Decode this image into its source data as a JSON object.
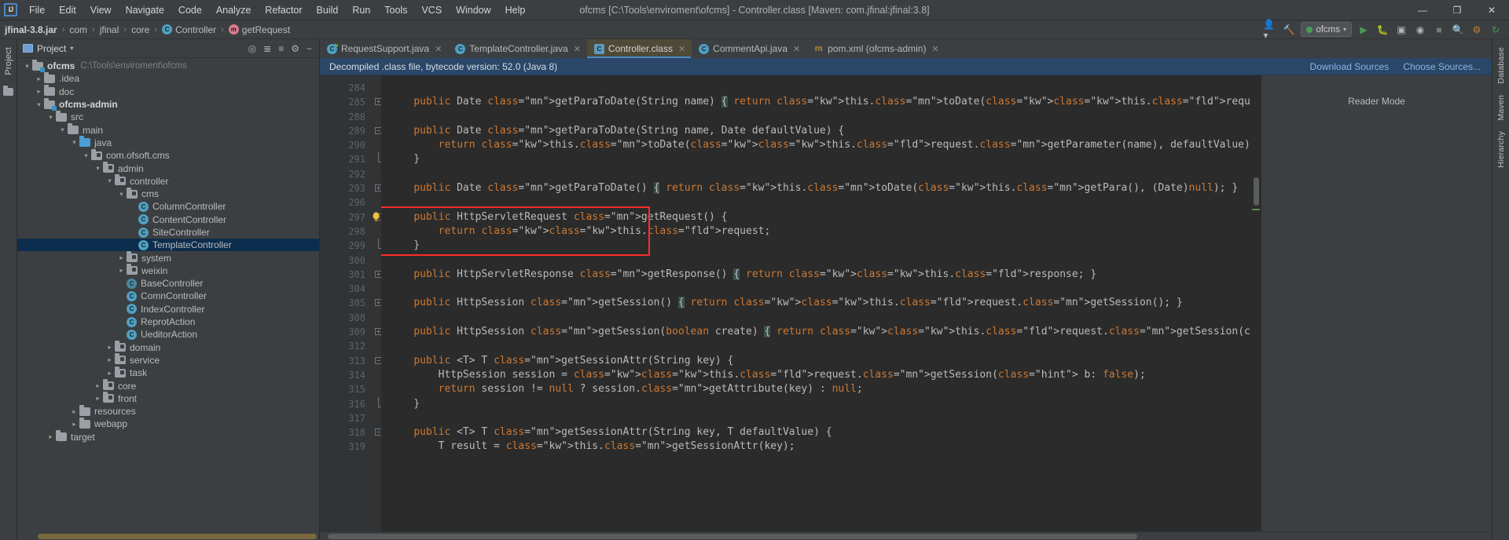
{
  "window": {
    "title": "ofcms [C:\\Tools\\enviroment\\ofcms] - Controller.class [Maven: com.jfinal:jfinal:3.8]",
    "logo": "IJ",
    "minimize": "—",
    "maximize": "❐",
    "close": "✕"
  },
  "menu": [
    {
      "label": "File"
    },
    {
      "label": "Edit"
    },
    {
      "label": "View"
    },
    {
      "label": "Navigate"
    },
    {
      "label": "Code"
    },
    {
      "label": "Analyze"
    },
    {
      "label": "Refactor"
    },
    {
      "label": "Build"
    },
    {
      "label": "Run"
    },
    {
      "label": "Tools"
    },
    {
      "label": "VCS"
    },
    {
      "label": "Window"
    },
    {
      "label": "Help"
    }
  ],
  "breadcrumb": {
    "items": [
      {
        "label": "jfinal-3.8.jar",
        "icon": "none",
        "bold": true
      },
      {
        "label": "com",
        "icon": "none",
        "bold": false
      },
      {
        "label": "jfinal",
        "icon": "none",
        "bold": false
      },
      {
        "label": "core",
        "icon": "none",
        "bold": false
      },
      {
        "label": "Controller",
        "icon": "class-icon",
        "bold": false
      },
      {
        "label": "getRequest",
        "icon": "method-icon",
        "bold": false
      }
    ],
    "separator": "›",
    "class_glyph": "C",
    "method_glyph": "m"
  },
  "navbar_right": {
    "run_config": "ofcms",
    "icons": [
      "user-icon",
      "hammer-icon",
      "run-icon",
      "debug-icon",
      "coverage-icon",
      "profile-icon",
      "stop-icon",
      "search-icon",
      "settings-icon",
      "update-icon"
    ]
  },
  "left_rail": {
    "label": "Project",
    "icon": "folder-icon"
  },
  "right_rail": {
    "items": [
      "Database",
      "Maven",
      "Hierarchy"
    ]
  },
  "project_panel": {
    "title": "Project",
    "header_icons": [
      "target-icon",
      "collapse-icon",
      "expand-icon",
      "gear-icon",
      "hide-icon"
    ],
    "tree": [
      {
        "indent": 0,
        "arrow": "⌄",
        "kind": "folder-module",
        "label": "ofcms",
        "bold": true,
        "path": "C:\\Tools\\enviroment\\ofcms",
        "selected": false
      },
      {
        "indent": 1,
        "arrow": "›",
        "kind": "folder",
        "label": ".idea",
        "bold": false,
        "path": "",
        "selected": false
      },
      {
        "indent": 1,
        "arrow": "›",
        "kind": "folder",
        "label": "doc",
        "bold": false,
        "path": "",
        "selected": false
      },
      {
        "indent": 1,
        "arrow": "⌄",
        "kind": "folder-module",
        "label": "ofcms-admin",
        "bold": true,
        "path": "",
        "selected": false
      },
      {
        "indent": 2,
        "arrow": "⌄",
        "kind": "folder",
        "label": "src",
        "bold": false,
        "path": "",
        "selected": false
      },
      {
        "indent": 3,
        "arrow": "⌄",
        "kind": "folder",
        "label": "main",
        "bold": false,
        "path": "",
        "selected": false
      },
      {
        "indent": 4,
        "arrow": "⌄",
        "kind": "folder-blue",
        "label": "java",
        "bold": false,
        "path": "",
        "selected": false
      },
      {
        "indent": 5,
        "arrow": "⌄",
        "kind": "package",
        "label": "com.ofsoft.cms",
        "bold": false,
        "path": "",
        "selected": false
      },
      {
        "indent": 6,
        "arrow": "⌄",
        "kind": "package",
        "label": "admin",
        "bold": false,
        "path": "",
        "selected": false
      },
      {
        "indent": 7,
        "arrow": "⌄",
        "kind": "package",
        "label": "controller",
        "bold": false,
        "path": "",
        "selected": false
      },
      {
        "indent": 8,
        "arrow": "⌄",
        "kind": "package",
        "label": "cms",
        "bold": false,
        "path": "",
        "selected": false
      },
      {
        "indent": 9,
        "arrow": "",
        "kind": "class",
        "label": "ColumnController",
        "bold": false,
        "path": "",
        "selected": false
      },
      {
        "indent": 9,
        "arrow": "",
        "kind": "class",
        "label": "ContentController",
        "bold": false,
        "path": "",
        "selected": false
      },
      {
        "indent": 9,
        "arrow": "",
        "kind": "class",
        "label": "SiteController",
        "bold": false,
        "path": "",
        "selected": false
      },
      {
        "indent": 9,
        "arrow": "",
        "kind": "class",
        "label": "TemplateController",
        "bold": false,
        "path": "",
        "selected": true
      },
      {
        "indent": 8,
        "arrow": "›",
        "kind": "package",
        "label": "system",
        "bold": false,
        "path": "",
        "selected": false
      },
      {
        "indent": 8,
        "arrow": "›",
        "kind": "package",
        "label": "weixin",
        "bold": false,
        "path": "",
        "selected": false
      },
      {
        "indent": 8,
        "arrow": "",
        "kind": "class-abstract",
        "label": "BaseController",
        "bold": false,
        "path": "",
        "selected": false
      },
      {
        "indent": 8,
        "arrow": "",
        "kind": "class",
        "label": "ComnController",
        "bold": false,
        "path": "",
        "selected": false
      },
      {
        "indent": 8,
        "arrow": "",
        "kind": "class",
        "label": "IndexController",
        "bold": false,
        "path": "",
        "selected": false
      },
      {
        "indent": 8,
        "arrow": "",
        "kind": "class",
        "label": "ReprotAction",
        "bold": false,
        "path": "",
        "selected": false
      },
      {
        "indent": 8,
        "arrow": "",
        "kind": "class",
        "label": "UeditorAction",
        "bold": false,
        "path": "",
        "selected": false
      },
      {
        "indent": 7,
        "arrow": "›",
        "kind": "package",
        "label": "domain",
        "bold": false,
        "path": "",
        "selected": false
      },
      {
        "indent": 7,
        "arrow": "›",
        "kind": "package",
        "label": "service",
        "bold": false,
        "path": "",
        "selected": false
      },
      {
        "indent": 7,
        "arrow": "›",
        "kind": "package",
        "label": "task",
        "bold": false,
        "path": "",
        "selected": false
      },
      {
        "indent": 6,
        "arrow": "›",
        "kind": "package",
        "label": "core",
        "bold": false,
        "path": "",
        "selected": false
      },
      {
        "indent": 6,
        "arrow": "›",
        "kind": "package",
        "label": "front",
        "bold": false,
        "path": "",
        "selected": false
      },
      {
        "indent": 4,
        "arrow": "›",
        "kind": "folder",
        "label": "resources",
        "bold": false,
        "path": "",
        "selected": false
      },
      {
        "indent": 4,
        "arrow": "›",
        "kind": "folder",
        "label": "webapp",
        "bold": false,
        "path": "",
        "selected": false
      },
      {
        "indent": 2,
        "arrow": "›",
        "kind": "folder",
        "label": "target",
        "bold": false,
        "path": "",
        "selected": false
      }
    ]
  },
  "tabs": [
    {
      "label": "RequestSupport.java",
      "icon": "java-runnable-icon",
      "active": false
    },
    {
      "label": "TemplateController.java",
      "icon": "java-class-icon",
      "active": false
    },
    {
      "label": "Controller.class",
      "icon": "class-file-icon",
      "active": true
    },
    {
      "label": "CommentApi.java",
      "icon": "java-class-icon",
      "active": false
    },
    {
      "label": "pom.xml (ofcms-admin)",
      "icon": "maven-icon",
      "active": false
    }
  ],
  "notice": {
    "text": "Decompiled .class file, bytecode version: 52.0 (Java 8)",
    "download_sources": "Download Sources",
    "choose_sources": "Choose Sources..."
  },
  "reader_panel": {
    "label": "Reader Mode"
  },
  "editor": {
    "highlighted_symbol": "getRequest",
    "highlight_box_color": "#fb2c2c",
    "lines": [
      {
        "num": "284",
        "fold": "",
        "bulb": false,
        "code": ""
      },
      {
        "num": "285",
        "fold": "plus",
        "bulb": false,
        "code": "    public Date getParaToDate(String name) { return this.toDate(this.request.getParameter(name), (Date)null); }"
      },
      {
        "num": "288",
        "fold": "",
        "bulb": false,
        "code": ""
      },
      {
        "num": "289",
        "fold": "minus",
        "bulb": false,
        "code": "    public Date getParaToDate(String name, Date defaultValue) {"
      },
      {
        "num": "290",
        "fold": "",
        "bulb": false,
        "code": "        return this.toDate(this.request.getParameter(name), defaultValue);"
      },
      {
        "num": "291",
        "fold": "end",
        "bulb": false,
        "code": "    }"
      },
      {
        "num": "292",
        "fold": "",
        "bulb": false,
        "code": ""
      },
      {
        "num": "293",
        "fold": "plus",
        "bulb": false,
        "code": "    public Date getParaToDate() { return this.toDate(this.getPara(), (Date)null); }"
      },
      {
        "num": "296",
        "fold": "",
        "bulb": false,
        "code": ""
      },
      {
        "num": "297",
        "fold": "minus",
        "bulb": true,
        "code": "    public HttpServletRequest getRequest() {"
      },
      {
        "num": "298",
        "fold": "",
        "bulb": false,
        "code": "        return this.request;"
      },
      {
        "num": "299",
        "fold": "end",
        "bulb": false,
        "code": "    }"
      },
      {
        "num": "300",
        "fold": "",
        "bulb": false,
        "code": ""
      },
      {
        "num": "301",
        "fold": "plus",
        "bulb": false,
        "code": "    public HttpServletResponse getResponse() { return this.response; }"
      },
      {
        "num": "304",
        "fold": "",
        "bulb": false,
        "code": ""
      },
      {
        "num": "305",
        "fold": "plus",
        "bulb": false,
        "code": "    public HttpSession getSession() { return this.request.getSession(); }"
      },
      {
        "num": "308",
        "fold": "",
        "bulb": false,
        "code": ""
      },
      {
        "num": "309",
        "fold": "plus",
        "bulb": false,
        "code": "    public HttpSession getSession(boolean create) { return this.request.getSession(create); }"
      },
      {
        "num": "312",
        "fold": "",
        "bulb": false,
        "code": ""
      },
      {
        "num": "313",
        "fold": "minus",
        "bulb": false,
        "code": "    public <T> T getSessionAttr(String key) {"
      },
      {
        "num": "314",
        "fold": "",
        "bulb": false,
        "code": "        HttpSession session = this.request.getSession( b: false);"
      },
      {
        "num": "315",
        "fold": "",
        "bulb": false,
        "code": "        return session != null ? session.getAttribute(key) : null;"
      },
      {
        "num": "316",
        "fold": "end",
        "bulb": false,
        "code": "    }"
      },
      {
        "num": "317",
        "fold": "",
        "bulb": false,
        "code": ""
      },
      {
        "num": "318",
        "fold": "minus",
        "bulb": false,
        "code": "    public <T> T getSessionAttr(String key, T defaultValue) {"
      },
      {
        "num": "319",
        "fold": "",
        "bulb": false,
        "code": "        T result = this.getSessionAttr(key);"
      }
    ]
  },
  "colors": {
    "accent": "#4a88c7",
    "keyword": "#cc7832",
    "method": "#ffc66d",
    "field": "#9876aa",
    "text": "#a9b7c6",
    "selection": "#0d2d4e",
    "active_tab": "#4e4a38",
    "notice_bg": "#2b4767"
  }
}
